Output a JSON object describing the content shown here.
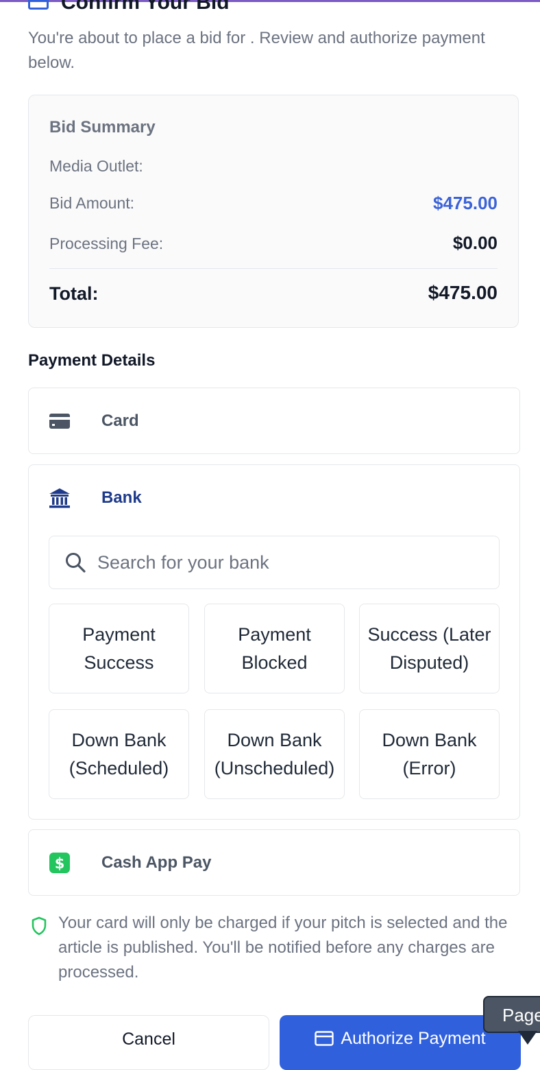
{
  "header": {
    "title": "Confirm Your Bid",
    "subtitle": "You're about to place a bid for . Review and authorize payment below."
  },
  "summary": {
    "title": "Bid Summary",
    "media_outlet_label": "Media Outlet:",
    "media_outlet_value": "",
    "bid_amount_label": "Bid Amount:",
    "bid_amount_value": "$475.00",
    "processing_fee_label": "Processing Fee:",
    "processing_fee_value": "$0.00",
    "total_label": "Total:",
    "total_value": "$475.00"
  },
  "payment": {
    "section_title": "Payment Details",
    "options": [
      {
        "label": "Card",
        "icon": "credit-card-icon",
        "selected": false
      },
      {
        "label": "Bank",
        "icon": "bank-icon",
        "selected": true
      },
      {
        "label": "Cash App Pay",
        "icon": "cash-app-icon",
        "selected": false
      }
    ],
    "bank_search": {
      "placeholder": "Search for your bank",
      "value": ""
    },
    "banks": [
      "Payment Success",
      "Payment Blocked",
      "Success (Later Disputed)",
      "Down Bank (Scheduled)",
      "Down Bank (Unscheduled)",
      "Down Bank (Error)"
    ]
  },
  "notice": {
    "icon": "shield-icon",
    "text": "Your card will only be charged if your pitch is selected and the article is published. You'll be notified before any charges are processed."
  },
  "actions": {
    "cancel_label": "Cancel",
    "authorize_label": "Authorize Payment"
  },
  "tooltip": {
    "text": "Page"
  },
  "colors": {
    "accent": "#3060dc",
    "bid_amount": "#3b63d9",
    "selected_option": "#1e3a8a",
    "shield": "#22c55e",
    "cash_app": "#22c55e"
  }
}
